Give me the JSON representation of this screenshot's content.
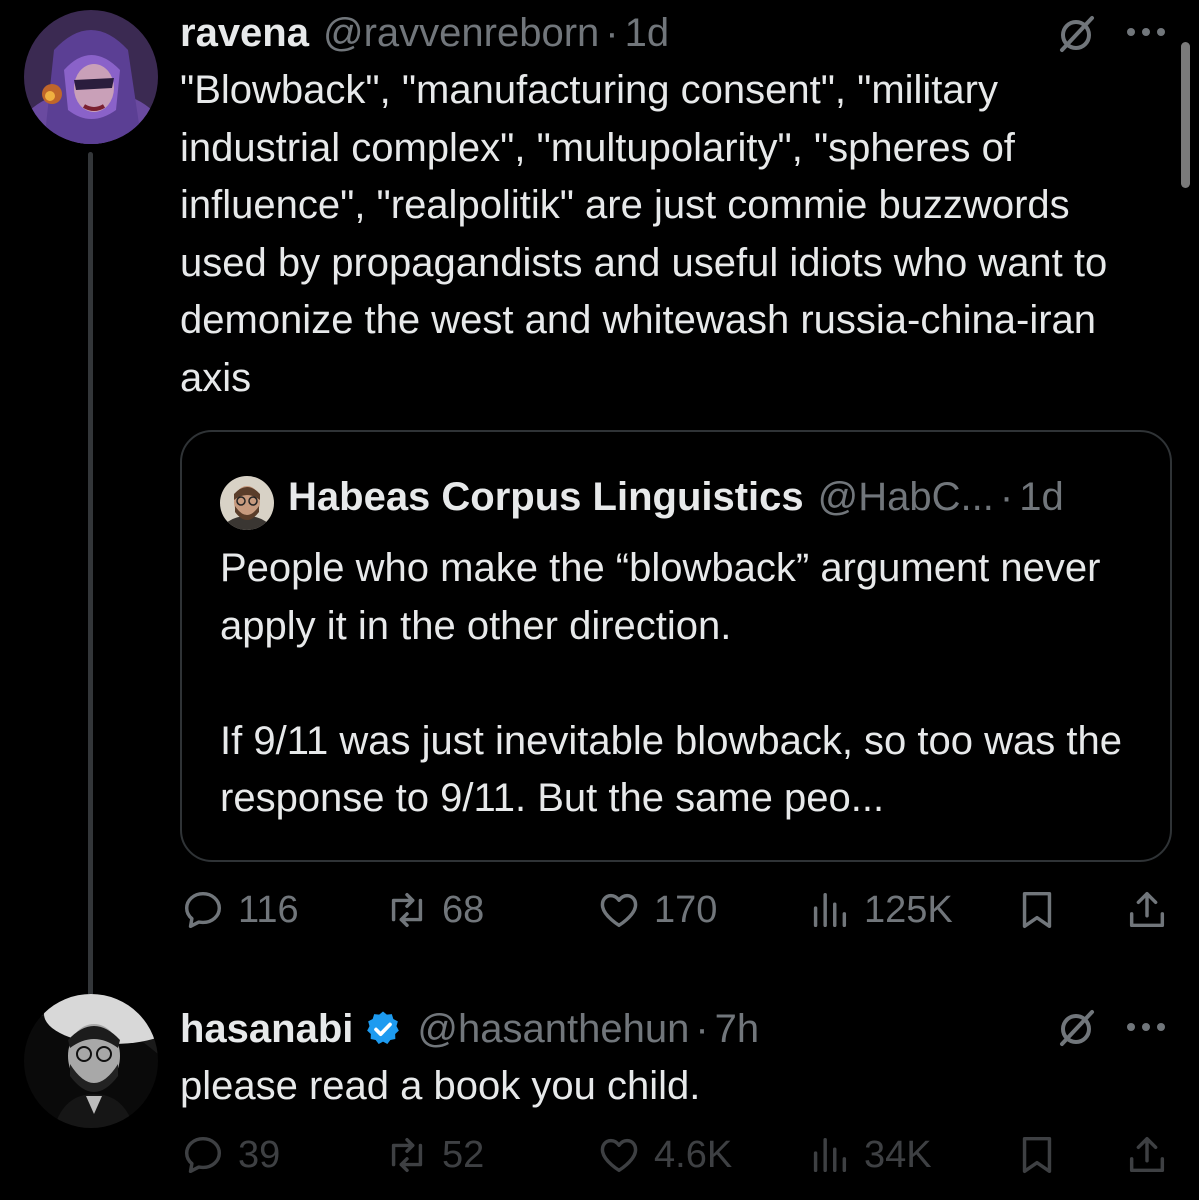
{
  "tweets": [
    {
      "display_name": "ravena",
      "handle": "@ravvenreborn",
      "separator": "·",
      "time": "1d",
      "text": "\"Blowback\", \"manufacturing consent\", \"military industrial complex\", \"multupolarity\", \"spheres of influence\", \"realpolitik\" are just commie buzzwords used by propagandists and useful idiots who want to demonize the west and whitewash russia-china-iran axis",
      "quote": {
        "display_name": "Habeas Corpus Linguistics",
        "handle": "@HabC...",
        "separator": "·",
        "time": "1d",
        "text": "People who make the “blowback” argument never apply it in the other direction.\n\nIf 9/11 was just inevitable blowback, so too was the response to 9/11. But the same peo..."
      },
      "stats": {
        "replies": "116",
        "retweets": "68",
        "likes": "170",
        "views": "125K"
      }
    },
    {
      "display_name": "hasanabi",
      "verified": true,
      "handle": "@hasanthehun",
      "separator": "·",
      "time": "7h",
      "text": "please read a book you child.",
      "stats": {
        "replies": "39",
        "retweets": "52",
        "likes": "4.6K",
        "views": "34K"
      }
    }
  ],
  "icons": {
    "reply": "speech-bubble-icon",
    "retweet": "retweet-arrows-icon",
    "like": "heart-icon",
    "views": "bar-chart-icon",
    "bookmark": "bookmark-icon",
    "share": "share-upload-icon",
    "grok": "grok-slash-circle-icon",
    "more": "more-dots-icon",
    "verified": "verified-badge-icon"
  },
  "colors": {
    "background": "#000000",
    "primary_text": "#e7e9ea",
    "secondary_text": "#71767b",
    "verified_blue": "#1d9bf0",
    "border": "#2f3336"
  }
}
